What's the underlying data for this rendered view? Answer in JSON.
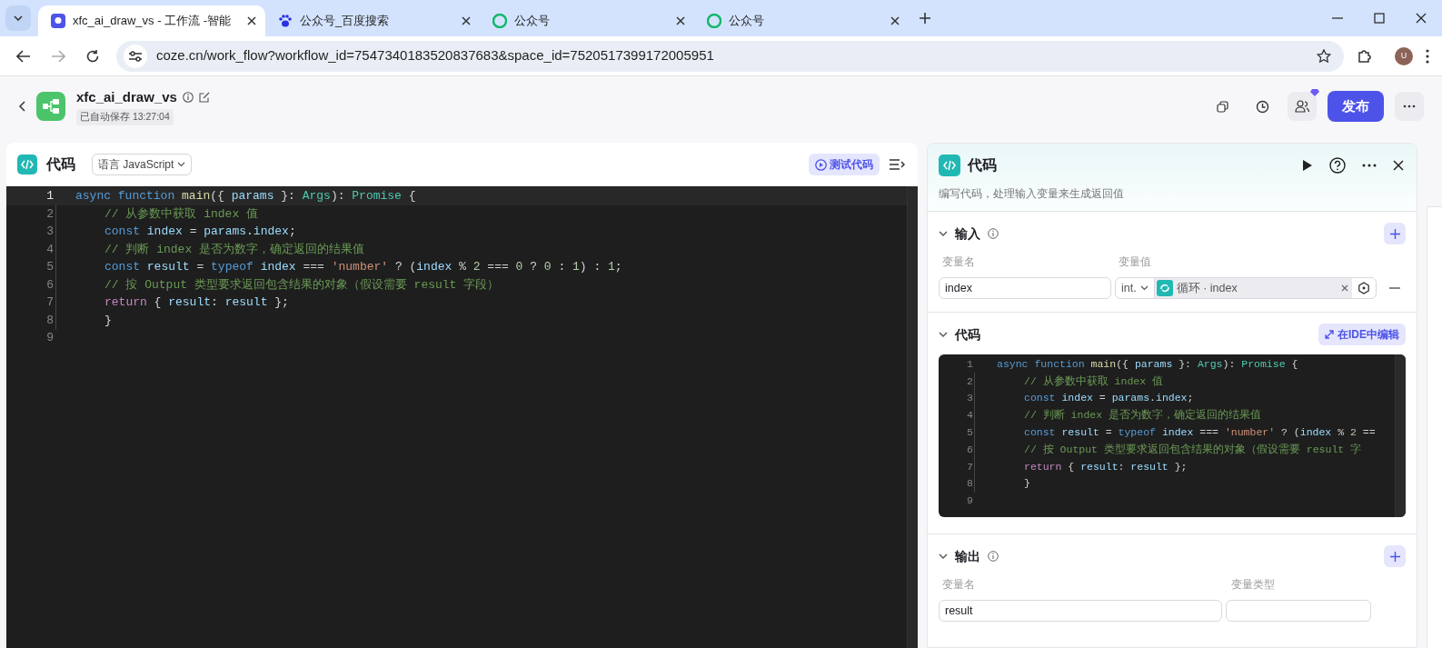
{
  "browser": {
    "tabs": [
      {
        "title": "xfc_ai_draw_vs - 工作流 -智能",
        "kind": "app",
        "selected": true
      },
      {
        "title": "公众号_百度搜索",
        "kind": "paw",
        "selected": false
      },
      {
        "title": "公众号",
        "kind": "swirl",
        "selected": false
      },
      {
        "title": "公众号",
        "kind": "swirl",
        "selected": false
      }
    ],
    "url": "coze.cn/work_flow?workflow_id=7547340183520837683&space_id=7520517399172005951",
    "profile": "U"
  },
  "header": {
    "title": "xfc_ai_draw_vs",
    "saved": "已自动保存 13:27:04",
    "publish": "发布"
  },
  "editor": {
    "title": "代码",
    "language": "语言 JavaScript",
    "test_button": "测试代码",
    "lines": [
      {
        "number": "1",
        "current": true,
        "indented": false,
        "tokens": [
          {
            "kind": "keyword",
            "text": "async "
          },
          {
            "kind": "keyword",
            "text": "function "
          },
          {
            "kind": "function",
            "text": "main"
          },
          {
            "kind": "punct",
            "text": "({ "
          },
          {
            "kind": "variable",
            "text": "params"
          },
          {
            "kind": "punct",
            "text": " }: "
          },
          {
            "kind": "type",
            "text": "Args"
          },
          {
            "kind": "punct",
            "text": "): "
          },
          {
            "kind": "type",
            "text": "Promise"
          },
          {
            "kind": "punct",
            "text": " {"
          }
        ]
      },
      {
        "number": "2",
        "current": false,
        "indented": true,
        "tokens": [
          {
            "kind": "comment",
            "text": "// 从参数中获取 index 值"
          }
        ]
      },
      {
        "number": "3",
        "current": false,
        "indented": true,
        "tokens": [
          {
            "kind": "keyword",
            "text": "const "
          },
          {
            "kind": "variable",
            "text": "index"
          },
          {
            "kind": "punct",
            "text": " = "
          },
          {
            "kind": "variable",
            "text": "params"
          },
          {
            "kind": "punct",
            "text": "."
          },
          {
            "kind": "variable",
            "text": "index"
          },
          {
            "kind": "punct",
            "text": ";"
          }
        ]
      },
      {
        "number": "4",
        "current": false,
        "indented": true,
        "tokens": [
          {
            "kind": "comment",
            "text": "// 判断 index 是否为数字，确定返回的结果值"
          }
        ]
      },
      {
        "number": "5",
        "current": false,
        "indented": true,
        "tokens": [
          {
            "kind": "keyword",
            "text": "const "
          },
          {
            "kind": "variable",
            "text": "result"
          },
          {
            "kind": "punct",
            "text": " = "
          },
          {
            "kind": "keyword",
            "text": "typeof "
          },
          {
            "kind": "variable",
            "text": "index"
          },
          {
            "kind": "punct",
            "text": " === "
          },
          {
            "kind": "string",
            "text": "'number'"
          },
          {
            "kind": "punct",
            "text": " ? ("
          },
          {
            "kind": "variable",
            "text": "index"
          },
          {
            "kind": "punct",
            "text": " % "
          },
          {
            "kind": "number",
            "text": "2"
          },
          {
            "kind": "punct",
            "text": " === "
          },
          {
            "kind": "number",
            "text": "0"
          },
          {
            "kind": "punct",
            "text": " ? "
          },
          {
            "kind": "number",
            "text": "0"
          },
          {
            "kind": "punct",
            "text": " : "
          },
          {
            "kind": "number",
            "text": "1"
          },
          {
            "kind": "punct",
            "text": ") : "
          },
          {
            "kind": "number",
            "text": "1"
          },
          {
            "kind": "punct",
            "text": ";"
          }
        ]
      },
      {
        "number": "6",
        "current": false,
        "indented": true,
        "tokens": [
          {
            "kind": "comment",
            "text": "// 按 Output 类型要求返回包含结果的对象（假设需要 result 字段）"
          }
        ]
      },
      {
        "number": "7",
        "current": false,
        "indented": true,
        "tokens": [
          {
            "kind": "control",
            "text": "return "
          },
          {
            "kind": "punct",
            "text": "{ "
          },
          {
            "kind": "variable",
            "text": "result"
          },
          {
            "kind": "punct",
            "text": ": "
          },
          {
            "kind": "variable",
            "text": "result"
          },
          {
            "kind": "punct",
            "text": " };"
          }
        ]
      },
      {
        "number": "8",
        "current": false,
        "indented": true,
        "tokens": [
          {
            "kind": "punct",
            "text": "}"
          }
        ]
      },
      {
        "number": "9",
        "current": false,
        "indented": false
      }
    ]
  },
  "panel": {
    "title": "代码",
    "description": "编写代码，处理输入变量来生成返回值",
    "input": {
      "title": "输入",
      "expanded": true,
      "name_label": "变量名",
      "value_label": "变量值",
      "rows": [
        {
          "name": "index",
          "type": "int.",
          "reference": "循环 · index"
        }
      ]
    },
    "code": {
      "title": "代码",
      "expanded": true,
      "ide_button": "在IDE中编辑",
      "lines": [
        {
          "number": "1",
          "indented": false,
          "tokens": [
            {
              "kind": "keyword",
              "text": "async "
            },
            {
              "kind": "keyword",
              "text": "function "
            },
            {
              "kind": "function",
              "text": "main"
            },
            {
              "kind": "punct",
              "text": "({ "
            },
            {
              "kind": "variable",
              "text": "params"
            },
            {
              "kind": "punct",
              "text": " }: "
            },
            {
              "kind": "type",
              "text": "Args"
            },
            {
              "kind": "punct",
              "text": "): "
            },
            {
              "kind": "type",
              "text": "Promise"
            },
            {
              "kind": "punct",
              "text": " {"
            }
          ]
        },
        {
          "number": "2",
          "indented": true,
          "tokens": [
            {
              "kind": "comment",
              "text": "// 从参数中获取 index 值"
            }
          ]
        },
        {
          "number": "3",
          "indented": true,
          "tokens": [
            {
              "kind": "keyword",
              "text": "const "
            },
            {
              "kind": "variable",
              "text": "index"
            },
            {
              "kind": "punct",
              "text": " = "
            },
            {
              "kind": "variable",
              "text": "params"
            },
            {
              "kind": "punct",
              "text": "."
            },
            {
              "kind": "variable",
              "text": "index"
            },
            {
              "kind": "punct",
              "text": ";"
            }
          ]
        },
        {
          "number": "4",
          "indented": true,
          "tokens": [
            {
              "kind": "comment",
              "text": "// 判断 index 是否为数字，确定返回的结果值"
            }
          ]
        },
        {
          "number": "5",
          "indented": true,
          "tokens": [
            {
              "kind": "keyword",
              "text": "const "
            },
            {
              "kind": "variable",
              "text": "result"
            },
            {
              "kind": "punct",
              "text": " = "
            },
            {
              "kind": "keyword",
              "text": "typeof "
            },
            {
              "kind": "variable",
              "text": "index"
            },
            {
              "kind": "punct",
              "text": " === "
            },
            {
              "kind": "string",
              "text": "'number'"
            },
            {
              "kind": "punct",
              "text": " ? ("
            },
            {
              "kind": "variable",
              "text": "index"
            },
            {
              "kind": "punct",
              "text": " % "
            },
            {
              "kind": "number",
              "text": "2"
            },
            {
              "kind": "punct",
              "text": " =="
            }
          ]
        },
        {
          "number": "6",
          "indented": true,
          "tokens": [
            {
              "kind": "comment",
              "text": "// 按 Output 类型要求返回包含结果的对象（假设需要 result 字"
            }
          ]
        },
        {
          "number": "7",
          "indented": true,
          "tokens": [
            {
              "kind": "control",
              "text": "return "
            },
            {
              "kind": "punct",
              "text": "{ "
            },
            {
              "kind": "variable",
              "text": "result"
            },
            {
              "kind": "punct",
              "text": ": "
            },
            {
              "kind": "variable",
              "text": "result"
            },
            {
              "kind": "punct",
              "text": " };"
            }
          ]
        },
        {
          "number": "8",
          "indented": true,
          "tokens": [
            {
              "kind": "punct",
              "text": "}"
            }
          ]
        },
        {
          "number": "9",
          "indented": false
        }
      ]
    },
    "output": {
      "title": "输出",
      "expanded": true,
      "name_label": "变量名",
      "type_label": "变量类型",
      "rows": [
        {
          "name": "result"
        }
      ]
    }
  }
}
